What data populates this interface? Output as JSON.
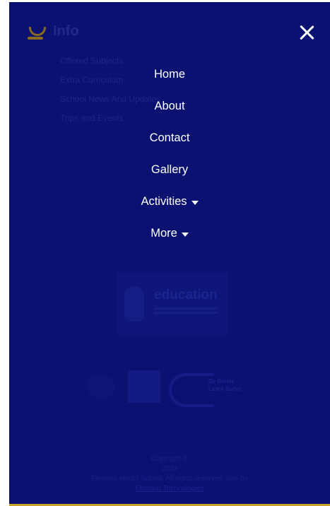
{
  "background_page": {
    "title": "Info",
    "links": [
      "Offered Subjects",
      "Extra Curriculum",
      "School News And Updates",
      "Trips and Events"
    ],
    "education_logo_text": "education",
    "partner_text": [
      "Be Better,",
      "Learn Better"
    ],
    "footer": {
      "copyright": "Copyright ©",
      "year": "2023",
      "rights": "Ebomvu Model School. All rights reserved. Site by",
      "credit": "Ebomvu Technologies"
    }
  },
  "menu": {
    "items": [
      {
        "label": "Home"
      },
      {
        "label": "About"
      },
      {
        "label": "Contact"
      },
      {
        "label": "Gallery"
      },
      {
        "label": "Activities",
        "dropdown": true
      },
      {
        "label": "More",
        "dropdown": true
      }
    ]
  },
  "icons": {
    "close": "close-icon",
    "caret": "caret-down-icon",
    "logo": "school-logo-icon"
  },
  "colors": {
    "overlay": "#0a1170",
    "text": "#ffffff",
    "accent": "#c9a227"
  }
}
